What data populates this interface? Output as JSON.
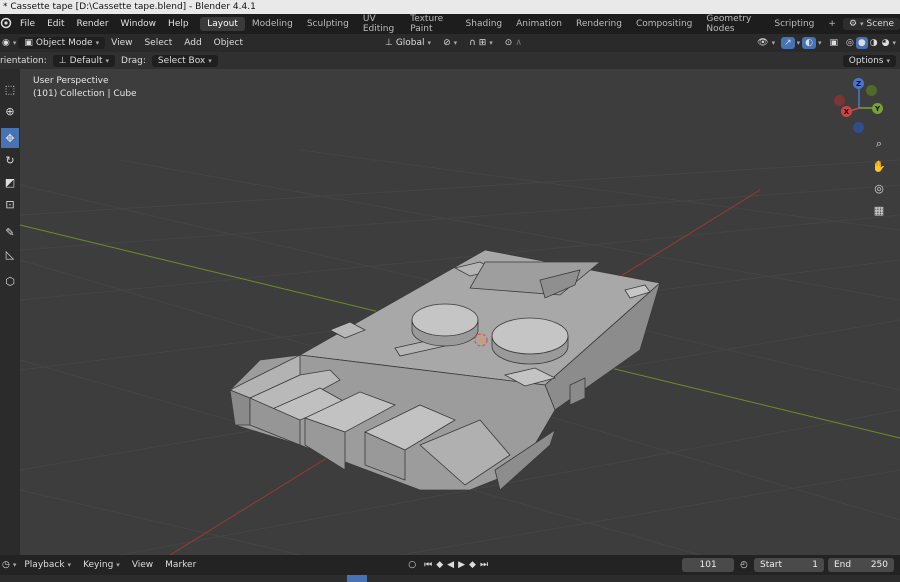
{
  "window": {
    "title": "* Cassette tape [D:\\Cassette tape.blend] - Blender 4.4.1"
  },
  "menu": {
    "items": [
      "File",
      "Edit",
      "Render",
      "Window",
      "Help"
    ]
  },
  "workspaces": [
    "Layout",
    "Modeling",
    "Sculpting",
    "UV Editing",
    "Texture Paint",
    "Shading",
    "Animation",
    "Rendering",
    "Compositing",
    "Geometry Nodes",
    "Scripting"
  ],
  "workspace_add": "+",
  "scene": {
    "label": "Scene"
  },
  "header": {
    "mode": "Object Mode",
    "menus": [
      "View",
      "Select",
      "Add",
      "Object"
    ],
    "orientation": "Global"
  },
  "toolsettings": {
    "orientation_label": "rientation:",
    "orientation_value": "Default",
    "drag_label": "Drag:",
    "drag_value": "Select Box",
    "options": "Options"
  },
  "viewport": {
    "perspective": "User Perspective",
    "collection": "(101) Collection | Cube"
  },
  "gizmo": {
    "z": "Z",
    "y": "Y",
    "x": "X"
  },
  "timeline": {
    "playback": "Playback",
    "keying": "Keying",
    "view": "View",
    "marker": "Marker",
    "current_frame": "101",
    "start_label": "Start",
    "start_value": "1",
    "end_label": "End",
    "end_value": "250"
  }
}
